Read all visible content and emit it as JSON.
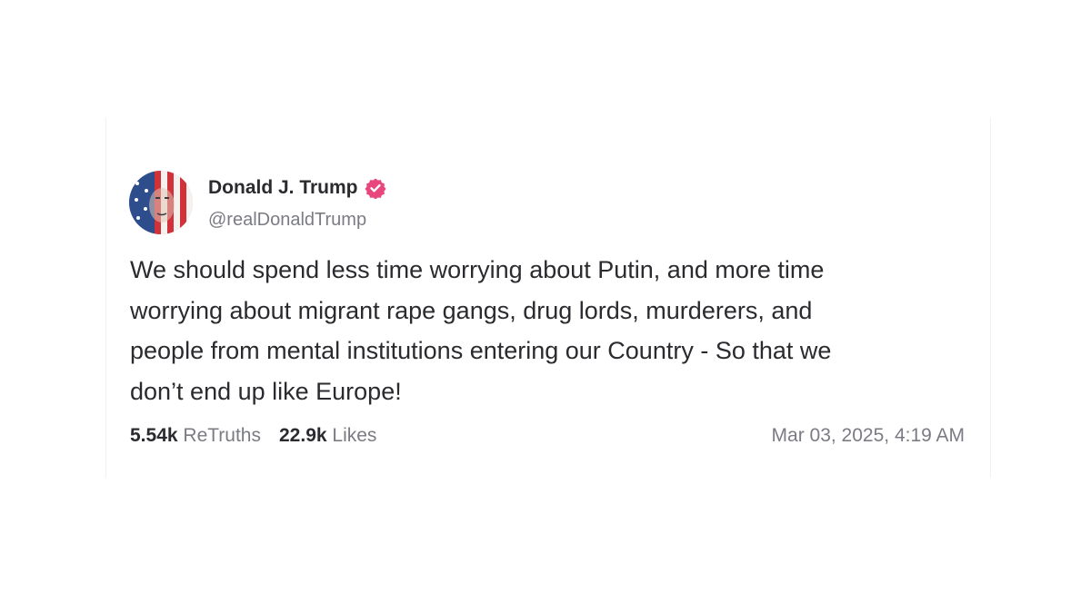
{
  "post": {
    "author": {
      "display_name": "Donald J. Trump",
      "handle": "@realDonaldTrump",
      "verified": true,
      "verified_icon": "verified-badge-icon",
      "avatar_icon": "avatar-image"
    },
    "text": "We should spend less time worrying about Putin, and more time\nworrying about migrant rape gangs, drug lords, murderers, and\npeople from mental institutions entering our Country - So that we\ndon’t end up like Europe!",
    "retruths": {
      "count": "5.54k",
      "label": "ReTruths"
    },
    "likes": {
      "count": "22.9k",
      "label": "Likes"
    },
    "timestamp": "Mar 03, 2025, 4:19 AM"
  },
  "colors": {
    "verified_badge": "#e8467c",
    "text_primary": "#2b2b2f",
    "text_secondary": "#7b7b84"
  }
}
